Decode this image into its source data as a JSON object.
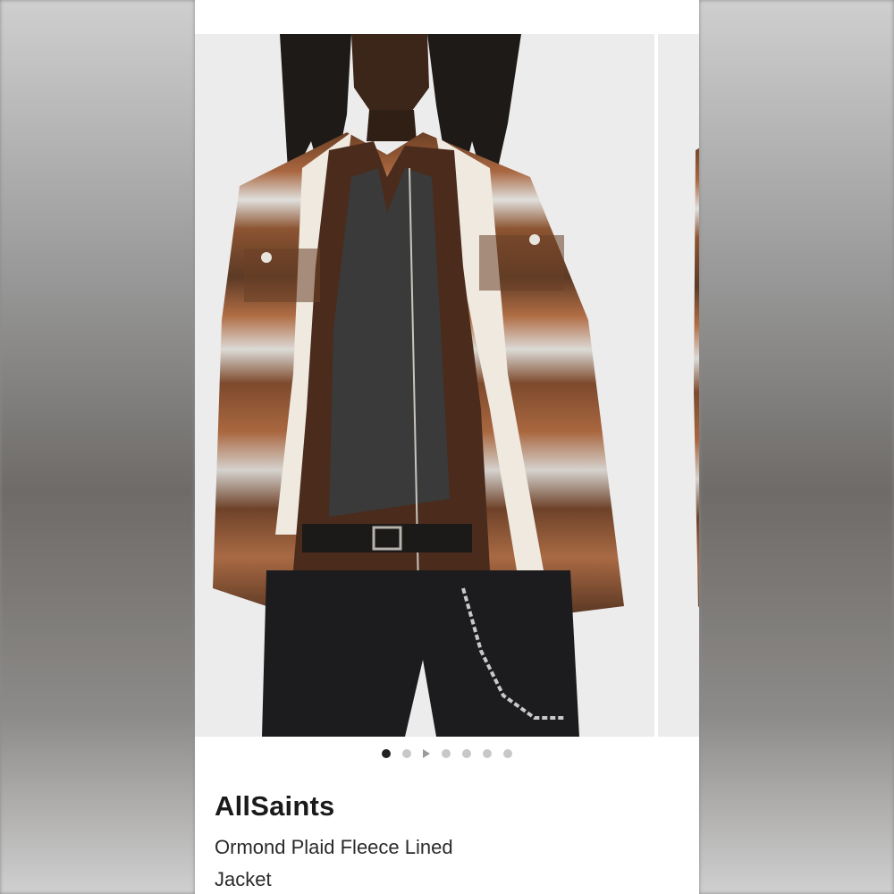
{
  "product": {
    "brand": "AllSaints",
    "title": "Ormond Plaid Fleece Lined Jacket"
  },
  "carousel": {
    "image_alt": "Model wearing brown plaid fleece lined jacket with black jeans and chain",
    "slide_count": 7,
    "active_index": 0,
    "video_indicator_index": 2
  },
  "colors": {
    "plaid_brown": "#7a4a2c",
    "plaid_rust": "#a5603a",
    "plaid_light": "#d8d6d3",
    "jeans": "#1c1c1e",
    "background": "#ececec"
  }
}
